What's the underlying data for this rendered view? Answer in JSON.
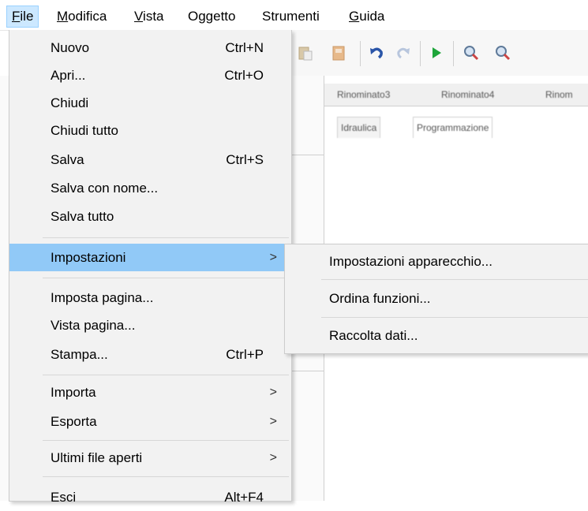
{
  "menubar": {
    "items": [
      {
        "mnemonic": "F",
        "rest": "ile"
      },
      {
        "mnemonic": "M",
        "rest": "odifica"
      },
      {
        "mnemonic": "V",
        "rest": "ista"
      },
      {
        "mnemonic": "",
        "rest": "Oggetto"
      },
      {
        "mnemonic": "",
        "rest": "Strumenti"
      },
      {
        "mnemonic": "G",
        "rest": "uida"
      }
    ]
  },
  "file_menu": {
    "nuovo": {
      "label": "Nuovo",
      "shortcut": "Ctrl+N"
    },
    "apri": {
      "label": "Apri...",
      "shortcut": "Ctrl+O"
    },
    "chiudi": {
      "label": "Chiudi"
    },
    "chiudi_tutto": {
      "label": "Chiudi tutto"
    },
    "salva": {
      "label": "Salva",
      "shortcut": "Ctrl+S"
    },
    "salva_con_nome": {
      "label": "Salva con nome..."
    },
    "salva_tutto": {
      "label": "Salva tutto"
    },
    "impostazioni": {
      "label": "Impostazioni",
      "arrow": ">"
    },
    "imposta_pagina": {
      "label": "Imposta pagina..."
    },
    "vista_pagina": {
      "label": "Vista pagina..."
    },
    "stampa": {
      "label": "Stampa...",
      "shortcut": "Ctrl+P"
    },
    "importa": {
      "label": "Importa",
      "arrow": ">"
    },
    "esporta": {
      "label": "Esporta",
      "arrow": ">"
    },
    "ultimi_file": {
      "label": "Ultimi file aperti",
      "arrow": ">"
    },
    "esci": {
      "label": "Esci",
      "shortcut": "Alt+F4"
    }
  },
  "impostazioni_submenu": {
    "apparecchio": "Impostazioni apparecchio...",
    "ordina": "Ordina funzioni...",
    "raccolta": "Raccolta dati..."
  },
  "document_tabs": [
    "Rinominato3",
    "Rinominato4",
    "Rinom"
  ],
  "view_tabs": [
    "Idraulica",
    "Programmazione"
  ],
  "colors": {
    "highlight": "#91c9f7",
    "menu_bg": "#f2f2f2",
    "menubar_active": "#cce8ff"
  }
}
